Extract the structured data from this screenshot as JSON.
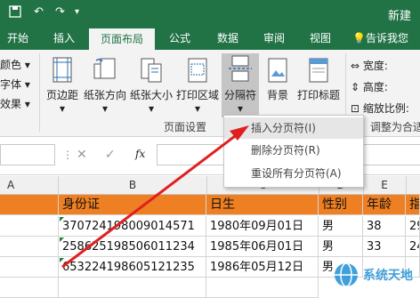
{
  "title_bar": {
    "doc_title": "新建"
  },
  "tabs": [
    "开始",
    "插入",
    "页面布局",
    "公式",
    "数据",
    "审阅",
    "视图"
  ],
  "active_tab": "页面布局",
  "tell_me": "告诉我您",
  "ribbon": {
    "left_partial": [
      "颜色",
      "字体",
      "效果"
    ],
    "buttons": {
      "margins": "页边距",
      "orientation": "纸张方向",
      "size": "纸张大小",
      "print_area": "打印区域",
      "breaks": "分隔符",
      "background": "背景",
      "print_titles": "打印标题"
    },
    "group_page_setup": "页面设置",
    "scale": {
      "width": "宽度:",
      "height": "高度:",
      "zoom": "缩放比例:"
    },
    "group_scale_to_fit": "调整为合适"
  },
  "breaks_menu": {
    "insert": "插入分页符(I)",
    "remove": "删除分页符(R)",
    "reset": "重设所有分页符(A)"
  },
  "formula_bar": {
    "fx": "fx"
  },
  "columns": [
    "A",
    "B",
    "C",
    "D",
    "E"
  ],
  "header_row": {
    "id": "身份证",
    "birth": "日生",
    "gender": "性别",
    "age": "年龄",
    "extra": "指"
  },
  "rows": [
    {
      "id": "370724198009014571",
      "birth": "1980年09月01日",
      "gender": "男",
      "age": "38",
      "extra": "29"
    },
    {
      "id": "258625198506011234",
      "birth": "1985年06月01日",
      "gender": "男",
      "age": "33",
      "extra": "24"
    },
    {
      "id": "653224198605121235",
      "birth": "1986年05月12日",
      "gender": "男",
      "age": "",
      "extra": ""
    }
  ],
  "watermark": "系统天地",
  "colors": {
    "excel_green": "#217346",
    "header_orange": "#ee7f22",
    "arrow_red": "#e02020"
  }
}
